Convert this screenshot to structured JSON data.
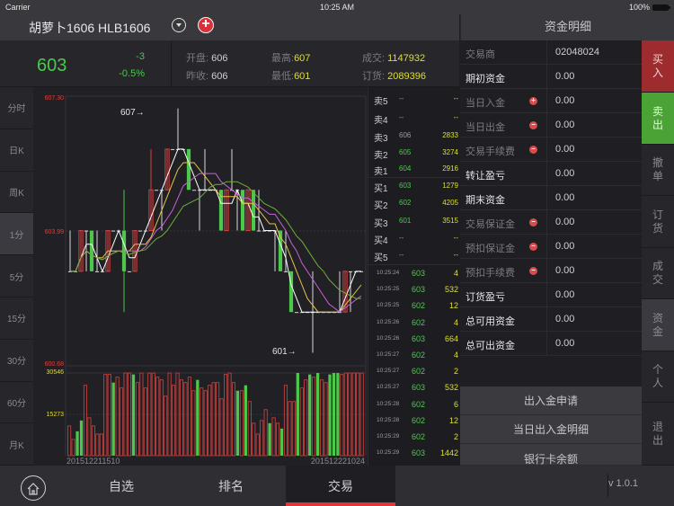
{
  "status_bar": {
    "carrier": "Carrier",
    "time": "10:25 AM",
    "battery": "100%"
  },
  "header": {
    "title": "胡萝卜1606  HLB1606",
    "right_title": "资金明细"
  },
  "quote": {
    "last": "603",
    "change": "-3",
    "change_pct": "-0.5%",
    "fields": [
      {
        "label": "开盘:",
        "value": "606",
        "highlight": false
      },
      {
        "label": "昨收:",
        "value": "606",
        "highlight": false
      },
      {
        "label": "最高:",
        "value": "607",
        "highlight": true
      },
      {
        "label": "最低:",
        "value": "601",
        "highlight": true
      },
      {
        "label": "成交:",
        "value": "1147932",
        "highlight": true
      },
      {
        "label": "订货:",
        "value": "2089396",
        "highlight": true
      }
    ]
  },
  "periods": [
    "分时",
    "日K",
    "周K",
    "1分",
    "5分",
    "15分",
    "30分",
    "60分",
    "月K"
  ],
  "active_period": "1分",
  "chart_data": {
    "type": "candlestick",
    "price_axis": {
      "max": "607.30",
      "mid": "603.99",
      "min": "600.68"
    },
    "volume_axis": {
      "max": "30546",
      "mid": "15273"
    },
    "annotations": {
      "high": "607→",
      "low": "601→"
    },
    "x_labels": [
      "201512211510",
      "201512221024"
    ],
    "price_levels": [
      601,
      602,
      603,
      604,
      605,
      606,
      607
    ],
    "closes": [
      603,
      603,
      604,
      604,
      603,
      603,
      603,
      604,
      604,
      604,
      603,
      603,
      604,
      604,
      604,
      605,
      605,
      605,
      606,
      606,
      606,
      606,
      605,
      605,
      605,
      605,
      605,
      605,
      604,
      605,
      605,
      605,
      604,
      605,
      604,
      604,
      604,
      604,
      604,
      603,
      603,
      602,
      602,
      602,
      602,
      602,
      602,
      602,
      602,
      602,
      602,
      603,
      603,
      603,
      603
    ],
    "ma_lines": [
      {
        "name": "MA5",
        "color": "#ffffff"
      },
      {
        "name": "MA10",
        "color": "#e6c34a"
      },
      {
        "name": "MA20",
        "color": "#c763d6"
      },
      {
        "name": "MA30",
        "color": "#6fae3a"
      }
    ],
    "volumes": [
      11,
      6,
      9,
      13,
      26,
      14,
      11,
      8,
      8,
      30,
      30,
      27,
      29,
      25,
      31,
      32,
      30,
      27,
      32,
      25,
      33,
      32,
      29,
      28,
      22,
      34,
      26,
      32,
      28,
      27,
      29,
      24,
      28,
      25,
      24,
      26,
      27,
      27,
      21,
      30,
      32,
      27,
      24,
      24,
      26,
      20,
      12,
      8,
      13,
      17,
      12,
      14,
      12,
      10,
      26,
      20,
      20,
      35,
      25,
      28,
      30,
      29,
      35,
      28,
      27,
      30,
      31,
      31,
      30,
      32,
      36,
      37,
      37,
      34
    ]
  },
  "order_book": {
    "asks": [
      {
        "label": "卖5",
        "price": "--",
        "volume": "--"
      },
      {
        "label": "卖4",
        "price": "--",
        "volume": "--"
      },
      {
        "label": "卖3",
        "price": "606",
        "volume": "2833"
      },
      {
        "label": "卖2",
        "price": "605",
        "volume": "3274"
      },
      {
        "label": "卖1",
        "price": "604",
        "volume": "2916"
      }
    ],
    "bids": [
      {
        "label": "买1",
        "price": "603",
        "volume": "1279"
      },
      {
        "label": "买2",
        "price": "602",
        "volume": "4205"
      },
      {
        "label": "买3",
        "price": "601",
        "volume": "3515"
      },
      {
        "label": "买4",
        "price": "--",
        "volume": "--"
      },
      {
        "label": "买5",
        "price": "--",
        "volume": "--"
      }
    ]
  },
  "ticks": [
    {
      "time": "10:25:24",
      "price": "603",
      "volume": "4"
    },
    {
      "time": "10:25:25",
      "price": "603",
      "volume": "532"
    },
    {
      "time": "10:25:25",
      "price": "602",
      "volume": "12"
    },
    {
      "time": "10:25:26",
      "price": "602",
      "volume": "4"
    },
    {
      "time": "10:25:26",
      "price": "603",
      "volume": "664"
    },
    {
      "time": "10:25:27",
      "price": "602",
      "volume": "4"
    },
    {
      "time": "10:25:27",
      "price": "602",
      "volume": "2"
    },
    {
      "time": "10:25:27",
      "price": "603",
      "volume": "532"
    },
    {
      "time": "10:25:28",
      "price": "602",
      "volume": "6"
    },
    {
      "time": "10:25:28",
      "price": "602",
      "volume": "12"
    },
    {
      "time": "10:25:29",
      "price": "602",
      "volume": "2"
    },
    {
      "time": "10:25:29",
      "price": "603",
      "volume": "1442"
    }
  ],
  "funds": [
    {
      "label": "交易商",
      "value": "02048024",
      "style": "dim",
      "badge": ""
    },
    {
      "label": "期初资金",
      "value": "0.00",
      "style": "bright",
      "badge": ""
    },
    {
      "label": "当日入金",
      "value": "0.00",
      "style": "dim",
      "badge": "+"
    },
    {
      "label": "当日出金",
      "value": "0.00",
      "style": "dim",
      "badge": "−"
    },
    {
      "label": "交易手续费",
      "value": "0.00",
      "style": "dim",
      "badge": "−"
    },
    {
      "label": "转让盈亏",
      "value": "0.00",
      "style": "bright",
      "badge": ""
    },
    {
      "label": "期末资金",
      "value": "0.00",
      "style": "bright",
      "badge": ""
    },
    {
      "label": "交易保证金",
      "value": "0.00",
      "style": "dim",
      "badge": "−"
    },
    {
      "label": "预扣保证金",
      "value": "0.00",
      "style": "dim",
      "badge": "−"
    },
    {
      "label": "预扣手续费",
      "value": "0.00",
      "style": "dim",
      "badge": "−"
    },
    {
      "label": "订货盈亏",
      "value": "0.00",
      "style": "bright",
      "badge": ""
    },
    {
      "label": "总可用资金",
      "value": "0.00",
      "style": "bright",
      "badge": ""
    },
    {
      "label": "总可出资金",
      "value": "0.00",
      "style": "bright",
      "badge": ""
    }
  ],
  "fund_actions": [
    "出入金申请",
    "当日出入金明细",
    "银行卡余额"
  ],
  "side_buttons": [
    {
      "label": "买\n入",
      "kind": "buy"
    },
    {
      "label": "卖\n出",
      "kind": "sell"
    },
    {
      "label": "撤\n单",
      "kind": ""
    },
    {
      "label": "订\n货",
      "kind": ""
    },
    {
      "label": "成\n交",
      "kind": ""
    },
    {
      "label": "资\n金",
      "kind": "active"
    },
    {
      "label": "个\n人",
      "kind": ""
    },
    {
      "label": "退\n出",
      "kind": ""
    }
  ],
  "bottom_tabs": [
    "自选",
    "排名",
    "交易"
  ],
  "active_tab": "交易",
  "version": "v 1.0.1",
  "colors": {
    "up": "#d9403f",
    "down": "#4cc94a",
    "highlight": "#dede3a",
    "accent": "#e3343a"
  }
}
